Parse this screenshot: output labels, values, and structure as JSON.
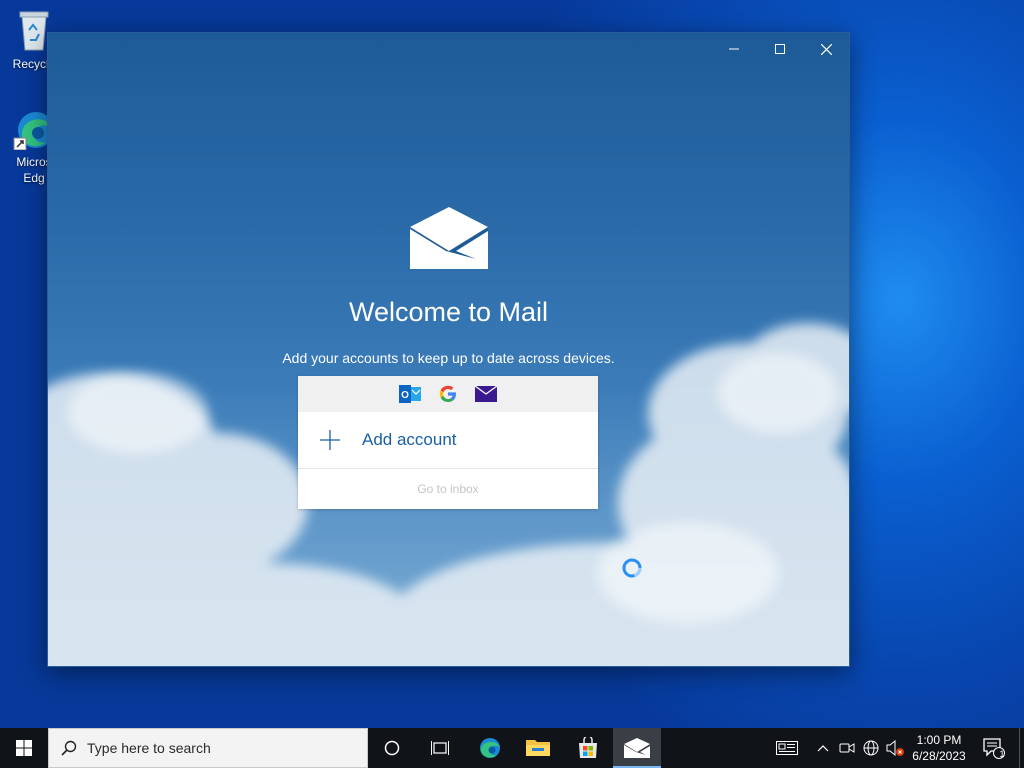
{
  "desktop": {
    "icons": [
      {
        "label": "Recycle",
        "icon": "recycle-bin-icon"
      },
      {
        "label": "Micros",
        "label2": "Edg",
        "icon": "edge-icon"
      }
    ]
  },
  "window": {
    "app": "Mail",
    "controls": [
      "minimize",
      "maximize",
      "close"
    ],
    "welcome_title": "Welcome to Mail",
    "subtitle": "Add your accounts to keep up to date across devices.",
    "providers": [
      "outlook-icon",
      "google-icon",
      "mail-envelope-icon"
    ],
    "add_account_label": "Add account",
    "go_to_inbox_label": "Go to inbox"
  },
  "taskbar": {
    "search_placeholder": "Type here to search",
    "pinned": [
      "cortana-icon",
      "task-view-icon",
      "edge-icon",
      "file-explorer-icon",
      "store-icon",
      "mail-icon"
    ],
    "active_app": "Mail",
    "clock_time": "1:00 PM",
    "clock_date": "6/28/2023",
    "notification_count": "1"
  },
  "colors": {
    "accent": "#1a5fa8",
    "taskbar_bg": "#101418",
    "desktop_blue": "#0a5fd0"
  }
}
